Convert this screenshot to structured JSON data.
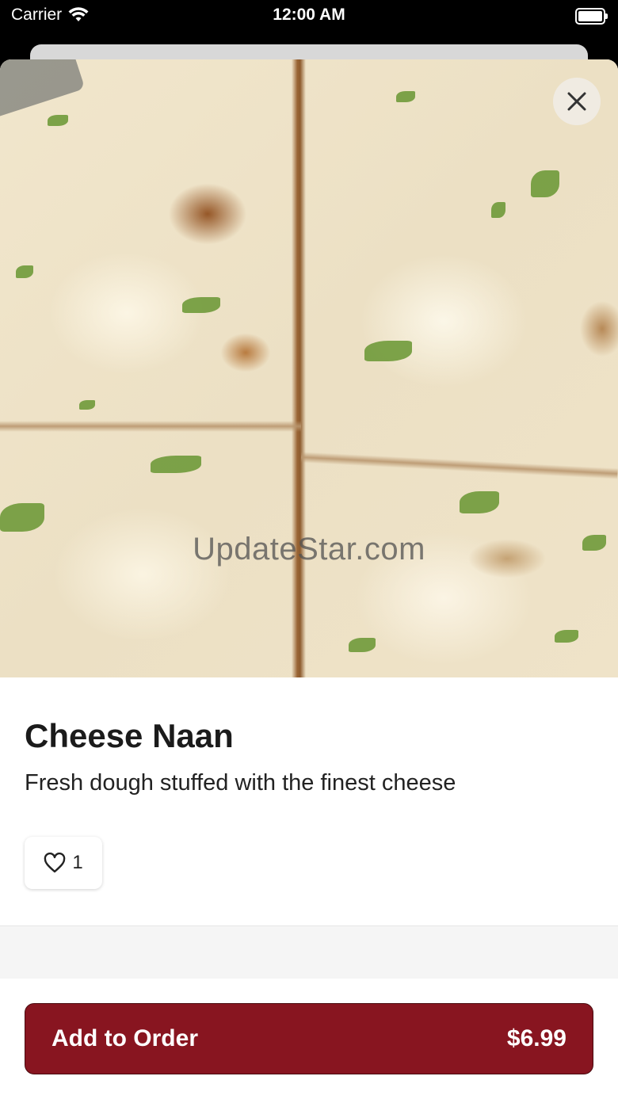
{
  "status_bar": {
    "carrier": "Carrier",
    "time": "12:00 AM",
    "icons": [
      "wifi-icon",
      "battery-icon"
    ]
  },
  "hero": {
    "image_subject": "cheese naan with herbs",
    "watermark": "UpdateStar.com",
    "close_icon": "close-icon"
  },
  "item": {
    "name": "Cheese Naan",
    "description": "Fresh dough stuffed with the finest cheese",
    "likes": "1",
    "like_icon": "heart-outline-icon"
  },
  "footer": {
    "add_label": "Add to Order",
    "price": "$6.99",
    "button_color": "#881520"
  }
}
